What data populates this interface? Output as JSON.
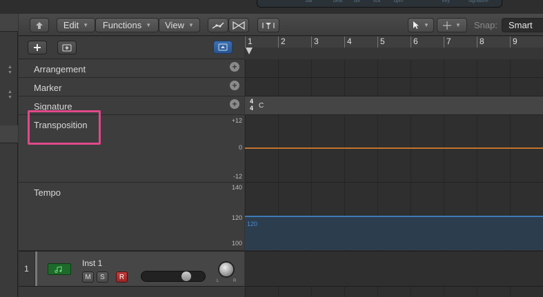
{
  "lcd": {
    "labels": [
      "bar",
      "beat",
      "div",
      "tick",
      "bpm",
      "key",
      "signature"
    ]
  },
  "toolbar": {
    "edit_label": "Edit",
    "functions_label": "Functions",
    "view_label": "View",
    "snap_label": "Snap:",
    "snap_value": "Smart"
  },
  "ruler": {
    "bars": [
      "1",
      "2",
      "3",
      "4",
      "5",
      "6",
      "7",
      "8",
      "9"
    ]
  },
  "global_tracks": {
    "arrangement": "Arrangement",
    "marker": "Marker",
    "signature": "Signature",
    "transposition": "Transposition",
    "transposition_max": "+12",
    "transposition_mid": "0",
    "transposition_min": "-12",
    "tempo": "Tempo",
    "tempo_max": "140",
    "tempo_mid": "120",
    "tempo_min": "100"
  },
  "signature_region": {
    "numerator": "4",
    "denominator": "4",
    "key": "C"
  },
  "tempo_region": {
    "value": "120"
  },
  "instrument_track": {
    "number": "1",
    "name": "Inst 1",
    "mute": "M",
    "solo": "S",
    "record": "R",
    "pan_left": "L",
    "pan_right": "R"
  },
  "colors": {
    "highlight": "#e1498b",
    "transposition_line": "#c4742e",
    "tempo_line": "#3e7bb8",
    "record_button": "#c03c3c"
  }
}
